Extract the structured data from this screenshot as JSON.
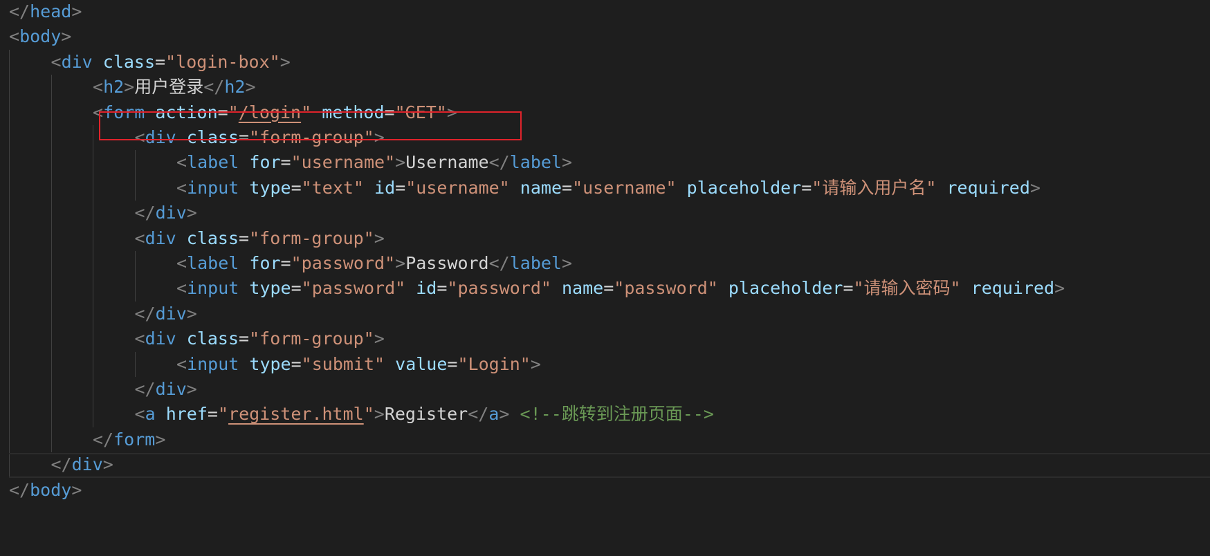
{
  "editor": {
    "colors": {
      "background": "#1e1e1e",
      "bracket": "#808080",
      "tag": "#569cd6",
      "attribute": "#9cdcfe",
      "string": "#ce9178",
      "text": "#d4d4d4",
      "comment": "#6a9955",
      "highlight_box": "#e0232b"
    },
    "lines": [
      {
        "indent": 0,
        "tokens": [
          [
            "bracket",
            "</"
          ],
          [
            "tag",
            "head"
          ],
          [
            "bracket",
            ">"
          ]
        ]
      },
      {
        "indent": 0,
        "tokens": [
          [
            "bracket",
            "<"
          ],
          [
            "tag",
            "body"
          ],
          [
            "bracket",
            ">"
          ]
        ]
      },
      {
        "indent": 1,
        "tokens": [
          [
            "bracket",
            "<"
          ],
          [
            "tag",
            "div"
          ],
          [
            "text",
            " "
          ],
          [
            "attr",
            "class"
          ],
          [
            "eq",
            "="
          ],
          [
            "str",
            "\"login-box\""
          ],
          [
            "bracket",
            ">"
          ]
        ]
      },
      {
        "indent": 2,
        "tokens": [
          [
            "bracket",
            "<"
          ],
          [
            "tag",
            "h2"
          ],
          [
            "bracket",
            ">"
          ],
          [
            "text",
            "用户登录"
          ],
          [
            "bracket",
            "</"
          ],
          [
            "tag",
            "h2"
          ],
          [
            "bracket",
            ">"
          ]
        ]
      },
      {
        "indent": 2,
        "highlighted": true,
        "tokens": [
          [
            "bracket",
            "<"
          ],
          [
            "tag",
            "form"
          ],
          [
            "text",
            " "
          ],
          [
            "attr",
            "action"
          ],
          [
            "eq",
            "="
          ],
          [
            "str",
            "\""
          ],
          [
            "strlink",
            "/login"
          ],
          [
            "str",
            "\""
          ],
          [
            "text",
            " "
          ],
          [
            "attr",
            "method"
          ],
          [
            "eq",
            "="
          ],
          [
            "str",
            "\"GET\""
          ],
          [
            "bracket",
            ">"
          ]
        ]
      },
      {
        "indent": 3,
        "tokens": [
          [
            "bracket",
            "<"
          ],
          [
            "tag",
            "div"
          ],
          [
            "text",
            " "
          ],
          [
            "attr",
            "class"
          ],
          [
            "eq",
            "="
          ],
          [
            "str",
            "\"form-group\""
          ],
          [
            "bracket",
            ">"
          ]
        ]
      },
      {
        "indent": 4,
        "tokens": [
          [
            "bracket",
            "<"
          ],
          [
            "tag",
            "label"
          ],
          [
            "text",
            " "
          ],
          [
            "attr",
            "for"
          ],
          [
            "eq",
            "="
          ],
          [
            "str",
            "\"username\""
          ],
          [
            "bracket",
            ">"
          ],
          [
            "text",
            "Username"
          ],
          [
            "bracket",
            "</"
          ],
          [
            "tag",
            "label"
          ],
          [
            "bracket",
            ">"
          ]
        ]
      },
      {
        "indent": 4,
        "tokens": [
          [
            "bracket",
            "<"
          ],
          [
            "tag",
            "input"
          ],
          [
            "text",
            " "
          ],
          [
            "attr",
            "type"
          ],
          [
            "eq",
            "="
          ],
          [
            "str",
            "\"text\""
          ],
          [
            "text",
            " "
          ],
          [
            "attr",
            "id"
          ],
          [
            "eq",
            "="
          ],
          [
            "str",
            "\"username\""
          ],
          [
            "text",
            " "
          ],
          [
            "attr",
            "name"
          ],
          [
            "eq",
            "="
          ],
          [
            "str",
            "\"username\""
          ],
          [
            "text",
            " "
          ],
          [
            "attr",
            "placeholder"
          ],
          [
            "eq",
            "="
          ],
          [
            "str",
            "\"请输入用户名\""
          ],
          [
            "text",
            " "
          ],
          [
            "attr",
            "required"
          ],
          [
            "bracket",
            ">"
          ]
        ]
      },
      {
        "indent": 3,
        "tokens": [
          [
            "bracket",
            "</"
          ],
          [
            "tag",
            "div"
          ],
          [
            "bracket",
            ">"
          ]
        ]
      },
      {
        "indent": 3,
        "tokens": [
          [
            "bracket",
            "<"
          ],
          [
            "tag",
            "div"
          ],
          [
            "text",
            " "
          ],
          [
            "attr",
            "class"
          ],
          [
            "eq",
            "="
          ],
          [
            "str",
            "\"form-group\""
          ],
          [
            "bracket",
            ">"
          ]
        ]
      },
      {
        "indent": 4,
        "tokens": [
          [
            "bracket",
            "<"
          ],
          [
            "tag",
            "label"
          ],
          [
            "text",
            " "
          ],
          [
            "attr",
            "for"
          ],
          [
            "eq",
            "="
          ],
          [
            "str",
            "\"password\""
          ],
          [
            "bracket",
            ">"
          ],
          [
            "text",
            "Password"
          ],
          [
            "bracket",
            "</"
          ],
          [
            "tag",
            "label"
          ],
          [
            "bracket",
            ">"
          ]
        ]
      },
      {
        "indent": 4,
        "tokens": [
          [
            "bracket",
            "<"
          ],
          [
            "tag",
            "input"
          ],
          [
            "text",
            " "
          ],
          [
            "attr",
            "type"
          ],
          [
            "eq",
            "="
          ],
          [
            "str",
            "\"password\""
          ],
          [
            "text",
            " "
          ],
          [
            "attr",
            "id"
          ],
          [
            "eq",
            "="
          ],
          [
            "str",
            "\"password\""
          ],
          [
            "text",
            " "
          ],
          [
            "attr",
            "name"
          ],
          [
            "eq",
            "="
          ],
          [
            "str",
            "\"password\""
          ],
          [
            "text",
            " "
          ],
          [
            "attr",
            "placeholder"
          ],
          [
            "eq",
            "="
          ],
          [
            "str",
            "\"请输入密码\""
          ],
          [
            "text",
            " "
          ],
          [
            "attr",
            "required"
          ],
          [
            "bracket",
            ">"
          ]
        ]
      },
      {
        "indent": 3,
        "tokens": [
          [
            "bracket",
            "</"
          ],
          [
            "tag",
            "div"
          ],
          [
            "bracket",
            ">"
          ]
        ]
      },
      {
        "indent": 3,
        "tokens": [
          [
            "bracket",
            "<"
          ],
          [
            "tag",
            "div"
          ],
          [
            "text",
            " "
          ],
          [
            "attr",
            "class"
          ],
          [
            "eq",
            "="
          ],
          [
            "str",
            "\"form-group\""
          ],
          [
            "bracket",
            ">"
          ]
        ]
      },
      {
        "indent": 4,
        "tokens": [
          [
            "bracket",
            "<"
          ],
          [
            "tag",
            "input"
          ],
          [
            "text",
            " "
          ],
          [
            "attr",
            "type"
          ],
          [
            "eq",
            "="
          ],
          [
            "str",
            "\"submit\""
          ],
          [
            "text",
            " "
          ],
          [
            "attr",
            "value"
          ],
          [
            "eq",
            "="
          ],
          [
            "str",
            "\"Login\""
          ],
          [
            "bracket",
            ">"
          ]
        ]
      },
      {
        "indent": 3,
        "tokens": [
          [
            "bracket",
            "</"
          ],
          [
            "tag",
            "div"
          ],
          [
            "bracket",
            ">"
          ]
        ]
      },
      {
        "indent": 3,
        "tokens": [
          [
            "bracket",
            "<"
          ],
          [
            "tag",
            "a"
          ],
          [
            "text",
            " "
          ],
          [
            "attr",
            "href"
          ],
          [
            "eq",
            "="
          ],
          [
            "str",
            "\""
          ],
          [
            "strlink",
            "register.html"
          ],
          [
            "str",
            "\""
          ],
          [
            "bracket",
            ">"
          ],
          [
            "text",
            "Register"
          ],
          [
            "bracket",
            "</"
          ],
          [
            "tag",
            "a"
          ],
          [
            "bracket",
            ">"
          ],
          [
            "text",
            " "
          ],
          [
            "comment",
            "<!--跳转到注册页面-->"
          ]
        ]
      },
      {
        "indent": 2,
        "tokens": [
          [
            "bracket",
            "</"
          ],
          [
            "tag",
            "form"
          ],
          [
            "bracket",
            ">"
          ]
        ]
      },
      {
        "indent": 1,
        "cursor": true,
        "tokens": [
          [
            "bracket",
            "</"
          ],
          [
            "tag",
            "div"
          ],
          [
            "bracket",
            ">"
          ]
        ]
      },
      {
        "indent": 0,
        "tokens": [
          [
            "bracket",
            "</"
          ],
          [
            "tag",
            "body"
          ],
          [
            "bracket",
            ">"
          ]
        ]
      }
    ]
  }
}
